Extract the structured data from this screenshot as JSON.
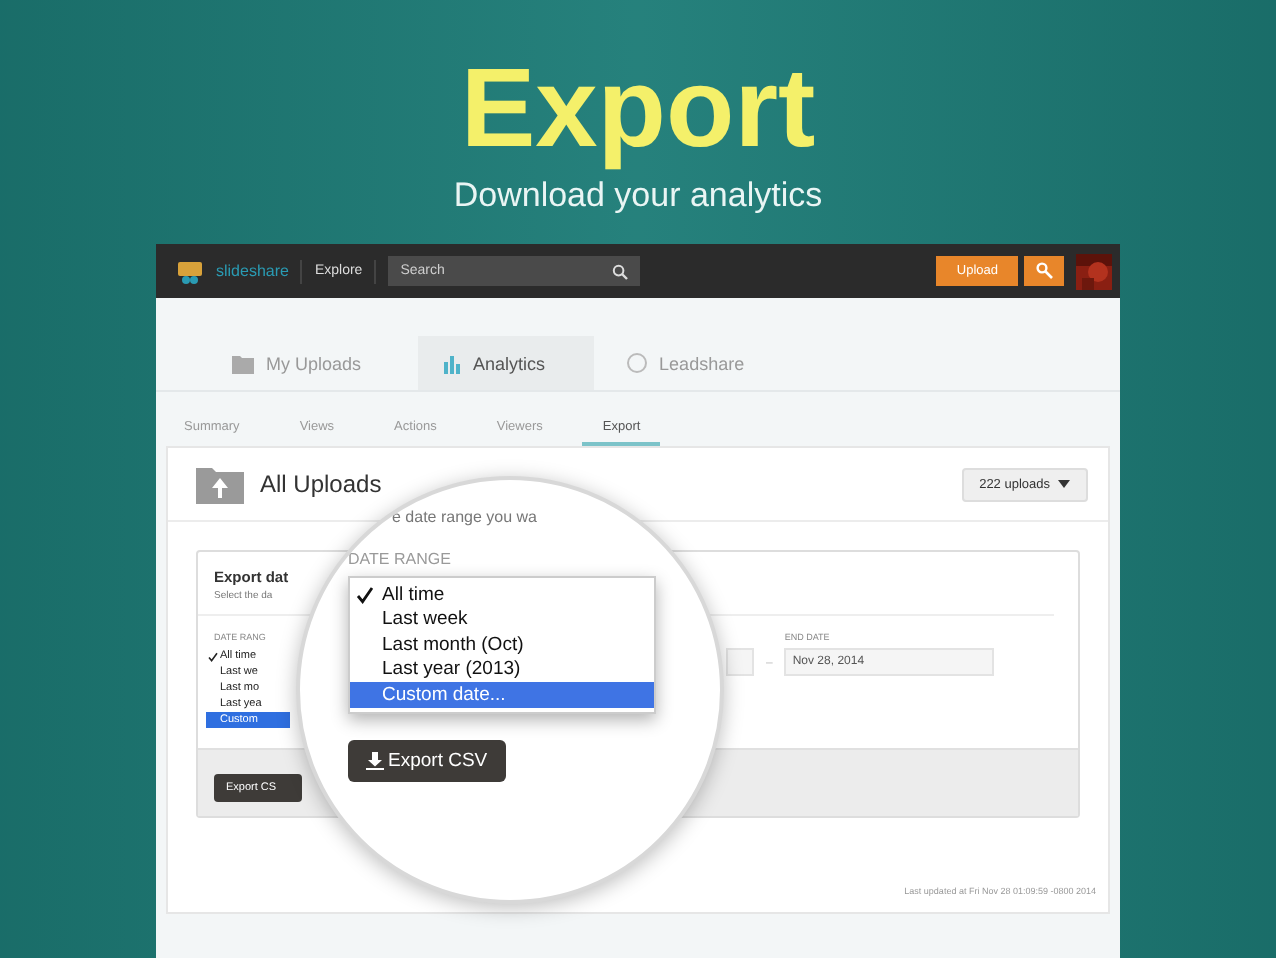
{
  "slide": {
    "title": "Export",
    "subtitle": "Download your analytics"
  },
  "navbar": {
    "logo": "slideshare",
    "link": "Explore",
    "search_placeholder": "Search",
    "upload_button": "Upload"
  },
  "main_tabs": [
    {
      "label": "My Uploads",
      "selected": false
    },
    {
      "label": "Analytics",
      "selected": true
    },
    {
      "label": "Leadshare",
      "selected": false
    }
  ],
  "sub_tabs": [
    {
      "label": "Summary",
      "selected": false
    },
    {
      "label": "Views",
      "selected": false
    },
    {
      "label": "Actions",
      "selected": false
    },
    {
      "label": "Viewers",
      "selected": false
    },
    {
      "label": "Export",
      "selected": true
    }
  ],
  "header": {
    "title": "All Uploads",
    "count_button": "222 uploads"
  },
  "export_panel": {
    "title": "Export dat",
    "hint": "Select the da",
    "range_label": "DATE RANG",
    "options": [
      {
        "label": "All time",
        "checked": true,
        "selected": false
      },
      {
        "label": "Last we",
        "checked": false,
        "selected": false
      },
      {
        "label": "Last mo",
        "checked": false,
        "selected": false
      },
      {
        "label": "Last yea",
        "checked": false,
        "selected": false
      },
      {
        "label": "Custom",
        "checked": false,
        "selected": true
      }
    ],
    "separator": "–",
    "end_date_label": "END DATE",
    "end_date": "Nov 28, 2014",
    "button": "Export CS"
  },
  "magnifier": {
    "caption": "e date range you wa",
    "range_label": "DATE RANGE",
    "options": [
      {
        "label": "All time",
        "checked": true,
        "selected": false
      },
      {
        "label": "Last week",
        "checked": false,
        "selected": false
      },
      {
        "label": "Last month (Oct)",
        "checked": false,
        "selected": false
      },
      {
        "label": "Last year (2013)",
        "checked": false,
        "selected": false
      },
      {
        "label": "Custom date...",
        "checked": false,
        "selected": true
      }
    ],
    "button": "Export CSV"
  },
  "footer": "Last updated at Fri Nov 28 01:09:59 -0800 2014"
}
